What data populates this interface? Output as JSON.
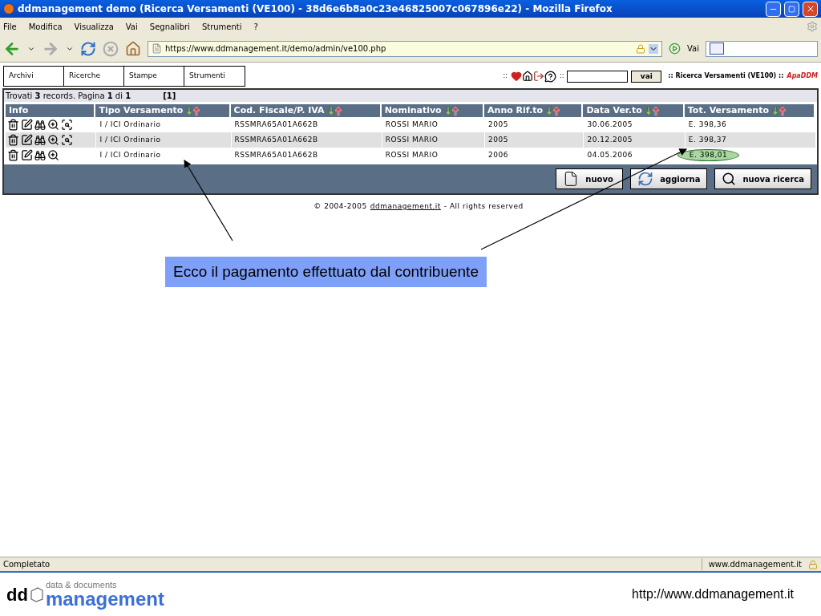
{
  "window": {
    "title": "ddmanagement demo (Ricerca Versamenti (VE100) - 38d6e6b8a0c23e46825007c067896e22) - Mozilla Firefox"
  },
  "menu": [
    "File",
    "Modifica",
    "Visualizza",
    "Vai",
    "Segnalibri",
    "Strumenti",
    "?"
  ],
  "toolbar": {
    "url": "https://www.ddmanagement.it/demo/admin/ve100.php",
    "go_label": "Vai"
  },
  "app_tabs": [
    "Archivi",
    "Ricerche",
    "Stampe",
    "Strumenti"
  ],
  "header": {
    "sep_left": "::",
    "sep_mid": "::",
    "search_button": "vai",
    "breadcrumb": ":: Ricerca Versamenti (VE100) ::",
    "brand": "ApaDDM"
  },
  "summary": {
    "text": "Trovati **3** records. Pagina **1** di **1**",
    "pages": "[1]"
  },
  "columns": [
    {
      "label": "Info",
      "sortable": false
    },
    {
      "label": "Tipo Versamento",
      "sortable": true
    },
    {
      "label": "Cod. Fiscale/P. IVA",
      "sortable": true
    },
    {
      "label": "Nominativo",
      "sortable": true
    },
    {
      "label": "Anno Rif.to",
      "sortable": true
    },
    {
      "label": "Data Ver.to",
      "sortable": true
    },
    {
      "label": "Tot. Versamento",
      "sortable": true
    }
  ],
  "rows": [
    {
      "cells": [
        "I / ICI Ordinario",
        "RSSMRA65A01A662B",
        "ROSSI MARIO",
        "2005",
        "30.06.2005",
        "E. 398,36"
      ],
      "has_select_icon": true,
      "circled": false
    },
    {
      "cells": [
        "I / ICI Ordinario",
        "RSSMRA65A01A662B",
        "ROSSI MARIO",
        "2005",
        "20.12.2005",
        "E. 398,37"
      ],
      "has_select_icon": true,
      "circled": false
    },
    {
      "cells": [
        "I / ICI Ordinario",
        "RSSMRA65A01A662B",
        "ROSSI MARIO",
        "2006",
        "04.05.2006",
        "E. 398,01"
      ],
      "has_select_icon": false,
      "circled": true
    }
  ],
  "buttons": [
    {
      "kind": "new",
      "label": "nuovo"
    },
    {
      "kind": "refresh",
      "label": "aggiorna"
    },
    {
      "kind": "search",
      "label": "nuova ricerca"
    }
  ],
  "footer": {
    "before": "© 2004-2005",
    "link": "ddmanagement.it",
    "after": "- All rights reserved"
  },
  "callout": "Ecco il pagamento effettuato dal contribuente",
  "status_bar": {
    "text": "Completato",
    "site": "www.ddmanagement.it"
  },
  "slide_footer": {
    "logo_prefix": "dd",
    "logo_tagline": "data & documents",
    "logo_name": "management",
    "url": "http://www.ddmanagement.it"
  }
}
